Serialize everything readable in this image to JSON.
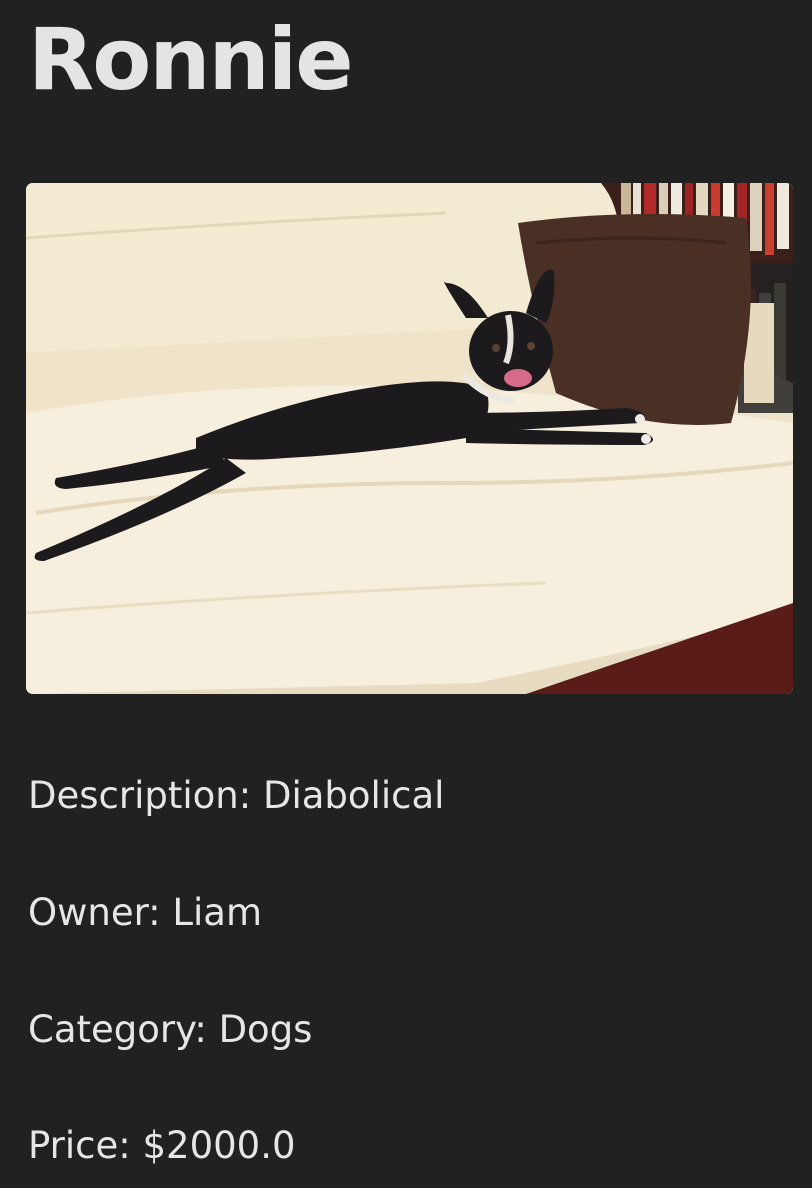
{
  "pet": {
    "name": "Ronnie",
    "details": [
      {
        "label": "Description",
        "value": "Diabolical"
      },
      {
        "label": "Owner",
        "value": "Liam"
      },
      {
        "label": "Category",
        "value": "Dogs"
      },
      {
        "label": "Price",
        "value": "$2000.0"
      }
    ],
    "photo_subject": "black-and-white-dog-on-cream-couch"
  },
  "colors": {
    "background": "#212121",
    "text": "#e6e6e6"
  }
}
